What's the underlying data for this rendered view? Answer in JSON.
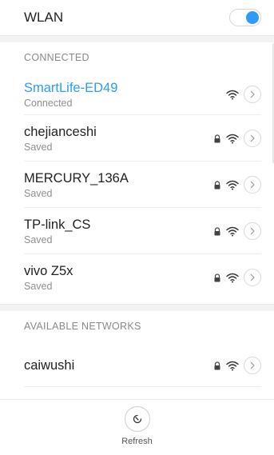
{
  "wlan": {
    "title": "WLAN",
    "enabled": true
  },
  "connected_section": {
    "header": "CONNECTED"
  },
  "saved_networks": [
    {
      "ssid": "SmartLife-ED49",
      "status": "Connected",
      "active": true,
      "locked": false,
      "icon": "wifi-icon"
    },
    {
      "ssid": "chejianceshi",
      "status": "Saved",
      "active": false,
      "locked": true,
      "icon": "wifi-icon"
    },
    {
      "ssid": "MERCURY_136A",
      "status": "Saved",
      "active": false,
      "locked": true,
      "icon": "wifi-icon"
    },
    {
      "ssid": "TP-link_CS",
      "status": "Saved",
      "active": false,
      "locked": true,
      "icon": "wifi-icon"
    },
    {
      "ssid": "vivo Z5x",
      "status": "Saved",
      "active": false,
      "locked": true,
      "icon": "wifi-icon"
    }
  ],
  "available_section": {
    "header": "AVAILABLE NETWORKS"
  },
  "available_networks": [
    {
      "ssid": "caiwushi",
      "locked": true,
      "icon": "wifi-icon"
    }
  ],
  "bottom": {
    "refresh_label": "Refresh"
  },
  "colors": {
    "accent": "#2f9bf7",
    "text": "#222222",
    "secondary": "#8f8f8f"
  }
}
